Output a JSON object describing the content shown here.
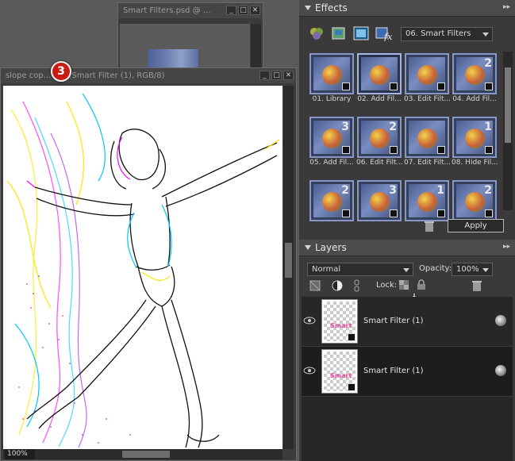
{
  "back_window": {
    "title": "Smart Filters.psd @ ..."
  },
  "front_window": {
    "title": "slope cop...  ...%(Smart Filter (1), RGB/8)",
    "zoom": "100%"
  },
  "badge": "3",
  "window_buttons": {
    "minimize": "_",
    "maximize": "□",
    "close": "✕"
  },
  "effects": {
    "title": "Effects",
    "more_icon": "▸▸",
    "category": "06. Smart Filters",
    "items": [
      {
        "label": "01. Library",
        "num": ""
      },
      {
        "label": "02. Add Fil...",
        "num": ""
      },
      {
        "label": "03. Edit Filt...",
        "num": ""
      },
      {
        "label": "04. Add Fil...",
        "num": "2"
      },
      {
        "label": "05. Add Fil...",
        "num": "3"
      },
      {
        "label": "06. Edit Filt...",
        "num": "2"
      },
      {
        "label": "07. Edit Filt...",
        "num": ""
      },
      {
        "label": "08. Hide Fil...",
        "num": "1"
      },
      {
        "label": "",
        "num": "2"
      },
      {
        "label": "",
        "num": "3"
      },
      {
        "label": "",
        "num": "1"
      },
      {
        "label": "",
        "num": "2"
      }
    ],
    "apply_label": "Apply"
  },
  "layers": {
    "title": "Layers",
    "more_icon": "▸▸",
    "blend_mode": "Normal",
    "opacity_label": "Opacity:",
    "opacity_value": "100%",
    "lock_label": "Lock:",
    "rows": [
      {
        "name": "Smart Filter (1)",
        "thumb_text": "Smart"
      },
      {
        "name": "Smart Filter (1)",
        "thumb_text": "Smart"
      }
    ]
  }
}
